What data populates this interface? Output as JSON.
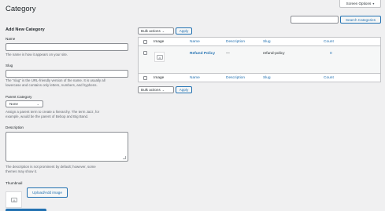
{
  "header": {
    "title": "Category",
    "screen_options_label": "Screen Options",
    "search_placeholder": "",
    "search_button_label": "Search Categories"
  },
  "form": {
    "heading": "Add New Category",
    "name_label": "Name",
    "name_value": "",
    "name_help": "The name is how it appears on your site.",
    "slug_label": "Slug",
    "slug_value": "",
    "slug_help_line1": "The “slug” is the URL-friendly version of the name. It is usually all",
    "slug_help_line2": "lowercase and contains only letters, numbers, and hyphens.",
    "parent_label": "Parent Category",
    "parent_selected": "None",
    "parent_help_line1": "Assign a parent term to create a hierarchy. The term Jazz, for",
    "parent_help_line2": "example, would be the parent of Bebop and Big Band.",
    "description_label": "Description",
    "description_value": "",
    "description_help_line1": "The description is not prominent by default; however, some",
    "description_help_line2": "themes may show it.",
    "thumbnail_label": "Thumbnail",
    "upload_button_label": "Upload/Add image"
  },
  "list": {
    "bulk_actions_top": "Bulk actions",
    "apply_top": "Apply",
    "bulk_actions_bottom": "Bulk actions",
    "apply_bottom": "Apply",
    "columns": {
      "image": "Image",
      "name": "Name",
      "description": "Description",
      "slug": "Slug",
      "count": "Count"
    },
    "rows": [
      {
        "name": "Refund Policy",
        "description": "—",
        "slug": "refund-policy",
        "count": "0"
      }
    ]
  },
  "icons": {
    "dropdown": "chevron-down-icon",
    "image_placeholder": "image-placeholder-icon"
  },
  "colors": {
    "background": "#f0f0f1",
    "link": "#2271b1",
    "border": "#c3c4c7",
    "primary_button": "#2271b1"
  }
}
